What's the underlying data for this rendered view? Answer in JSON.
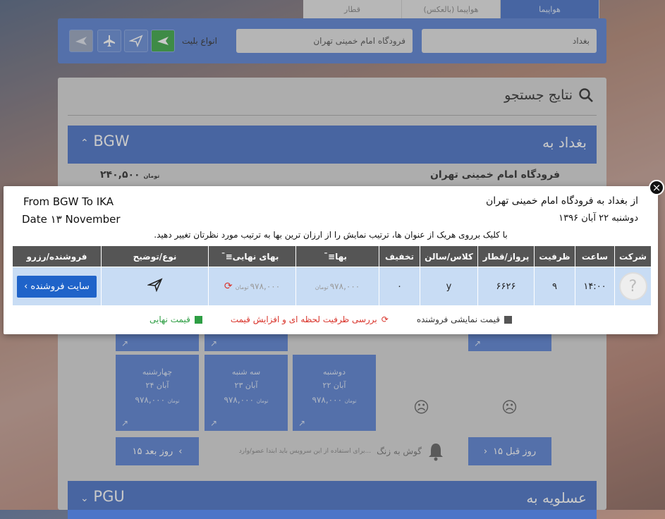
{
  "top_tabs": [
    {
      "label": "هواپیما",
      "active": true
    },
    {
      "label": "هواپیما (بالعکس)",
      "active": false
    },
    {
      "label": "قطار",
      "active": false
    }
  ],
  "search": {
    "origin": "بغداد",
    "destination": "فرودگاه امام خمینی تهران",
    "ticket_type_label": "انواع بلیت"
  },
  "results": {
    "title": "نتایج جستجو",
    "route1": {
      "city": "بغداد به",
      "code": "BGW"
    },
    "behind_row": {
      "airport": "فرودگاه امام خمینی تهران",
      "price": "۲۴۰,۵۰۰",
      "unit": "تومان"
    },
    "route2": {
      "city": "عسلویه به",
      "code": "PGU"
    }
  },
  "day_cards": [
    {
      "day": "چهارشنبه",
      "date": "۲۴ آبان",
      "price": "۹۷۸,۰۰۰",
      "unit": "تومان"
    },
    {
      "day": "سه شنبه",
      "date": "۲۳ آبان",
      "price": "۹۷۸,۰۰۰",
      "unit": "تومان"
    },
    {
      "day": "دوشنبه",
      "date": "۲۲ آبان",
      "price": "۹۷۸,۰۰۰",
      "unit": "تومان"
    }
  ],
  "nav": {
    "next_15": "۱۵ روز بعد",
    "prev_15": "۱۵ روز قبل",
    "bell_label": "گوش به زنگ",
    "bell_note": "برای استفاده از این سرویس باید ابتدا عضو/وارد..."
  },
  "modal": {
    "title_en": "From BGW To IKA",
    "date_en": "Date ۱۳ November",
    "title_fa": "از بغداد به فرودگاه امام خمینی تهران",
    "date_fa": "دوشنبه ۲۲ آبان ۱۳۹۶",
    "hint": "با کلیک برروی هریک از عنوان ها، ترتیب نمایش را از ارزان ترین بها به ترتیب مورد نظرتان تغییر دهید.",
    "columns": [
      "شرکت",
      "ساعت",
      "ظرفیت",
      "پرواز/قطار",
      "کلاس/سالن",
      "تخفیف",
      "بها",
      "بهای نهایی",
      "نوع/توضیح",
      "فروشنده/رزرو"
    ],
    "row": {
      "time": "۱۴:۰۰",
      "capacity": "۹",
      "flight": "۶۶۲۶",
      "class": "y",
      "discount": "۰",
      "price": "۹۷۸,۰۰۰",
      "final_price": "۹۷۸,۰۰۰",
      "unit": "تومان",
      "vendor_button": "سایت فروشنده ›"
    },
    "legend": [
      {
        "label": "قیمت نمایشی فروشنده",
        "color": "#555555"
      },
      {
        "label": "بررسی ظرفیت لحظه ای و افزایش قیمت",
        "color": "#d9342b"
      },
      {
        "label": "قیمت نهایی",
        "color": "#2e9e44"
      }
    ],
    "close": "×"
  }
}
